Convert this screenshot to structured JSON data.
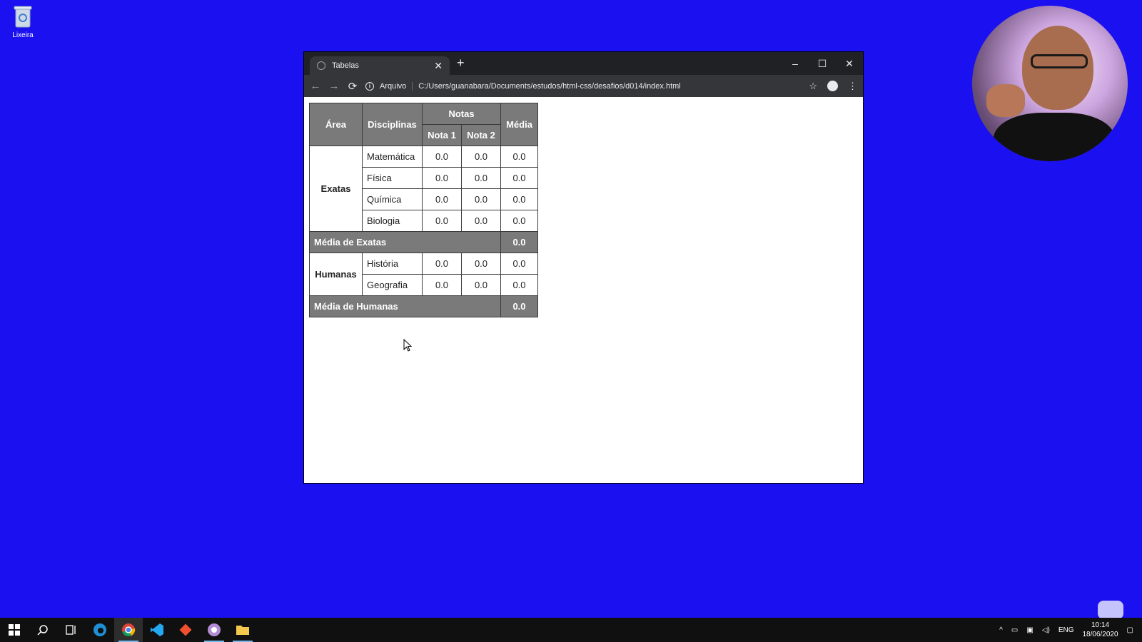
{
  "desktop": {
    "recycle_bin_label": "Lixeira"
  },
  "browser": {
    "tab_title": "Tabelas",
    "tab_close": "✕",
    "new_tab": "+",
    "controls": {
      "minimize": "–",
      "maximize": "☐",
      "close": "✕"
    },
    "nav": {
      "back": "←",
      "forward": "→",
      "reload": "⟳"
    },
    "address": {
      "info": "i",
      "scheme_label": "Arquivo",
      "url": "C:/Users/guanabara/Documents/estudos/html-css/desafios/d014/index.html"
    },
    "toolbar_icons": {
      "star": "☆",
      "menu": "⋮"
    }
  },
  "table": {
    "headers": {
      "area": "Área",
      "disciplinas": "Disciplinas",
      "notas": "Notas",
      "media": "Média",
      "nota1": "Nota 1",
      "nota2": "Nota 2"
    },
    "exatas": {
      "area": "Exatas",
      "rows": [
        {
          "disciplina": "Matemática",
          "nota1": "0.0",
          "nota2": "0.0",
          "media": "0.0"
        },
        {
          "disciplina": "Física",
          "nota1": "0.0",
          "nota2": "0.0",
          "media": "0.0"
        },
        {
          "disciplina": "Química",
          "nota1": "0.0",
          "nota2": "0.0",
          "media": "0.0"
        },
        {
          "disciplina": "Biologia",
          "nota1": "0.0",
          "nota2": "0.0",
          "media": "0.0"
        }
      ],
      "summary_label": "Média de Exatas",
      "summary_value": "0.0"
    },
    "humanas": {
      "area": "Humanas",
      "rows": [
        {
          "disciplina": "História",
          "nota1": "0.0",
          "nota2": "0.0",
          "media": "0.0"
        },
        {
          "disciplina": "Geografia",
          "nota1": "0.0",
          "nota2": "0.0",
          "media": "0.0"
        }
      ],
      "summary_label": "Média de Humanas",
      "summary_value": "0.0"
    }
  },
  "taskbar": {
    "language": "ENG",
    "time": "10:14",
    "date": "18/06/2020"
  },
  "colors": {
    "desktop_bg": "#1a10f0",
    "header_bg": "#7a7a7a",
    "chrome_dark": "#202124",
    "chrome_toolbar": "#35363a"
  }
}
